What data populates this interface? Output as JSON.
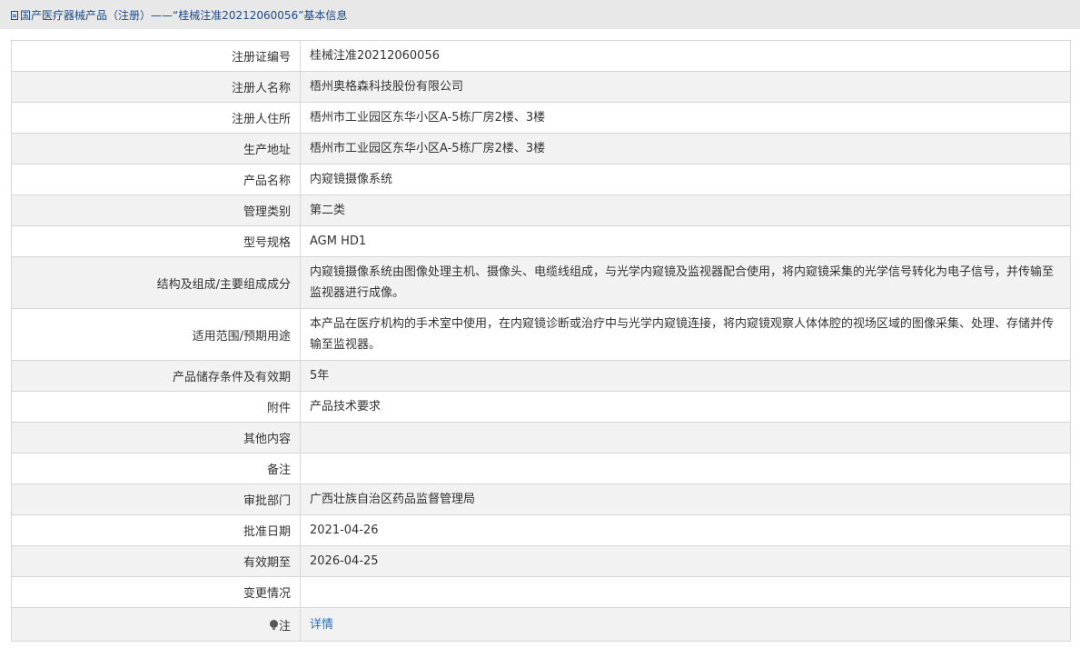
{
  "breadcrumb": {
    "icon": "document-icon",
    "text": "国产医疗器械产品（注册）——“桂械注准20212060056”基本信息"
  },
  "rows": [
    {
      "label": "注册证编号",
      "value": "桂械注准20212060056"
    },
    {
      "label": "注册人名称",
      "value": "梧州奥格森科技股份有限公司"
    },
    {
      "label": "注册人住所",
      "value": "梧州市工业园区东华小区A-5栋厂房2楼、3楼"
    },
    {
      "label": "生产地址",
      "value": "梧州市工业园区东华小区A-5栋厂房2楼、3楼"
    },
    {
      "label": "产品名称",
      "value": "内窥镜摄像系统"
    },
    {
      "label": "管理类别",
      "value": "第二类"
    },
    {
      "label": "型号规格",
      "value": "AGM HD1"
    },
    {
      "label": "结构及组成/主要组成成分",
      "value": "内窥镜摄像系统由图像处理主机、摄像头、电缆线组成，与光学内窥镜及监视器配合使用，将内窥镜采集的光学信号转化为电子信号，并传输至监视器进行成像。"
    },
    {
      "label": "适用范围/预期用途",
      "value": "本产品在医疗机构的手术室中使用，在内窥镜诊断或治疗中与光学内窥镜连接，将内窥镜观察人体体腔的视场区域的图像采集、处理、存储并传输至监视器。"
    },
    {
      "label": "产品储存条件及有效期",
      "value": "5年"
    },
    {
      "label": "附件",
      "value": "产品技术要求"
    },
    {
      "label": "其他内容",
      "value": ""
    },
    {
      "label": "备注",
      "value": ""
    },
    {
      "label": "审批部门",
      "value": "广西壮族自治区药品监督管理局"
    },
    {
      "label": "批准日期",
      "value": "2021-04-26"
    },
    {
      "label": "有效期至",
      "value": "2026-04-25"
    },
    {
      "label": "变更情况",
      "value": ""
    }
  ],
  "note": {
    "icon": "lightbulb-icon",
    "label": "注",
    "link_text": "详情"
  }
}
